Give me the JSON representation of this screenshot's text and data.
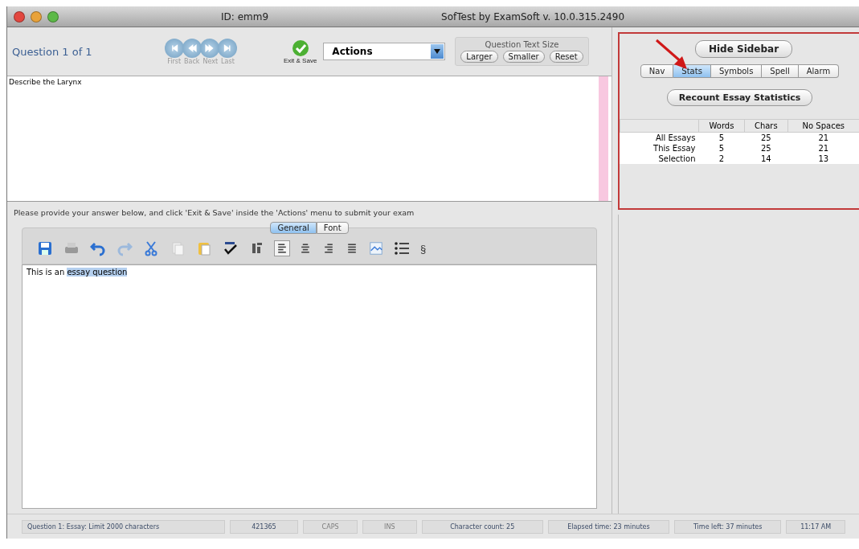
{
  "window": {
    "title_left": "ID: emm9",
    "title_right": "SofTest by ExamSoft v. 10.0.315.2490"
  },
  "toolbar": {
    "question_label": "Question 1 of 1",
    "nav_buttons": [
      "First",
      "Back",
      "Next",
      "Last"
    ],
    "exit_label": "Exit & Save",
    "actions": {
      "value": "Actions"
    },
    "text_size": {
      "title": "Question Text Size",
      "buttons": [
        "Larger",
        "Smaller",
        "Reset"
      ]
    }
  },
  "question": {
    "text": "Describe the Larynx"
  },
  "answer": {
    "instructions": "Please provide your answer below, and click 'Exit & Save' inside the 'Actions' menu to submit your exam",
    "tabs": [
      {
        "label": "General",
        "selected": true
      },
      {
        "label": "Font",
        "selected": false
      }
    ],
    "alignment_buttons": [
      {
        "selected": true
      },
      {
        "selected": false
      },
      {
        "selected": false
      },
      {
        "selected": false
      }
    ],
    "section_sign": "§",
    "text": "This is an ",
    "selected_text": "essay question"
  },
  "sidebar": {
    "hide_button": "Hide Sidebar",
    "tabs": [
      {
        "label": "Nav",
        "selected": false
      },
      {
        "label": "Stats",
        "selected": true
      },
      {
        "label": "Symbols",
        "selected": false
      },
      {
        "label": "Spell",
        "selected": false
      },
      {
        "label": "Alarm",
        "selected": false
      }
    ],
    "recount_button": "Recount Essay Statistics",
    "stats": {
      "columns": [
        "Words",
        "Chars",
        "No Spaces"
      ],
      "rows": [
        {
          "label": "All Essays",
          "values": [
            "5",
            "25",
            "21"
          ]
        },
        {
          "label": "This Essay",
          "values": [
            "5",
            "25",
            "21"
          ]
        },
        {
          "label": "Selection",
          "values": [
            "2",
            "14",
            "13"
          ]
        }
      ]
    }
  },
  "status_bar": [
    {
      "text": "Question 1: Essay: Limit 2000 characters",
      "active": true
    },
    {
      "text": "421365",
      "active": true
    },
    {
      "text": "CAPS",
      "active": false
    },
    {
      "text": "INS",
      "active": false
    },
    {
      "text": "Character count: 25",
      "active": true
    },
    {
      "text": "Elapsed time:  23 minutes",
      "active": true
    },
    {
      "text": "Time left:  37 minutes",
      "active": true
    },
    {
      "text": "11:17 AM",
      "active": true
    }
  ]
}
